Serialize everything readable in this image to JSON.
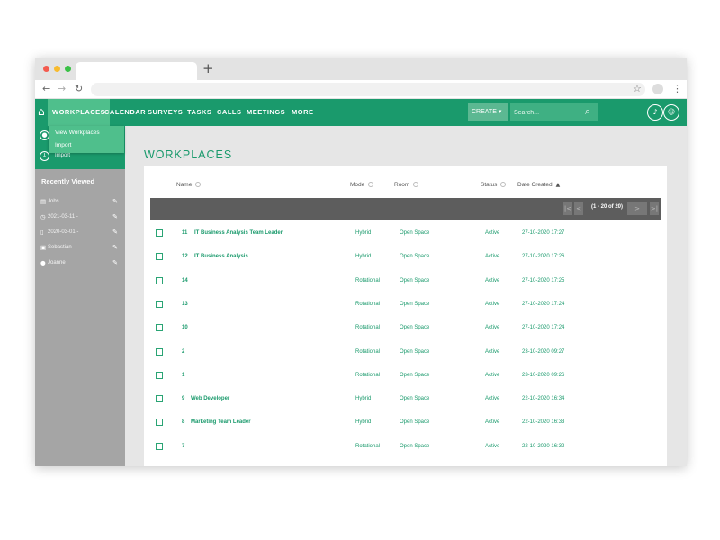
{
  "browser": {
    "new_tab": "+",
    "back": "←",
    "forward": "→",
    "reload": "↻",
    "star": "☆",
    "menu": "⋮"
  },
  "nav": {
    "items": [
      "WORKPLACES",
      "CALENDAR",
      "SURVEYS",
      "TASKS",
      "CALLS",
      "MEETINGS",
      "MORE"
    ],
    "create_label": "CREATE ▾",
    "search_placeholder": "Search...",
    "colors": {
      "primary": "#1a9a6c",
      "active": "#4fbf8c",
      "sidebar": "#a5a5a5"
    }
  },
  "dropdown": {
    "items": [
      "View Workplaces",
      "Import"
    ]
  },
  "sidebar": {
    "import_label": "Import",
    "recent_title": "Recently Viewed",
    "recent": [
      {
        "icon": "table-icon",
        "label": "Jobs"
      },
      {
        "icon": "clock-icon",
        "label": "2021-03-11 -"
      },
      {
        "icon": "document-icon",
        "label": "2020-03-01 -"
      },
      {
        "icon": "contact-icon",
        "label": "Sebastian"
      },
      {
        "icon": "user-icon",
        "label": "Joanne"
      }
    ]
  },
  "page": {
    "title": "WORKPLACES"
  },
  "table": {
    "headers": {
      "name": "Name",
      "mode": "Mode",
      "room": "Room",
      "status": "Status",
      "date": "Date Created"
    },
    "pager": {
      "range": "(1 - 20 of 20)",
      "first": "|<",
      "prev": "<",
      "next": ">",
      "last": ">|"
    },
    "rows": [
      {
        "num": "11",
        "name": "IT Business Analysis Team Leader",
        "mode": "Hybrid",
        "room": "Open Space",
        "status": "Active",
        "date": "27-10-2020 17:27"
      },
      {
        "num": "12",
        "name": "IT Business Analysis",
        "mode": "Hybrid",
        "room": "Open Space",
        "status": "Active",
        "date": "27-10-2020 17:26"
      },
      {
        "num": "14",
        "name": "",
        "mode": "Rotational",
        "room": "Open Space",
        "status": "Active",
        "date": "27-10-2020 17:25"
      },
      {
        "num": "13",
        "name": "",
        "mode": "Rotational",
        "room": "Open Space",
        "status": "Active",
        "date": "27-10-2020 17:24"
      },
      {
        "num": "10",
        "name": "",
        "mode": "Rotational",
        "room": "Open Space",
        "status": "Active",
        "date": "27-10-2020 17:24"
      },
      {
        "num": "2",
        "name": "",
        "mode": "Rotational",
        "room": "Open Space",
        "status": "Active",
        "date": "23-10-2020 09:27"
      },
      {
        "num": "1",
        "name": "",
        "mode": "Rotational",
        "room": "Open Space",
        "status": "Active",
        "date": "23-10-2020 09:26"
      },
      {
        "num": "9",
        "name": "Web Developer",
        "mode": "Hybrid",
        "room": "Open Space",
        "status": "Active",
        "date": "22-10-2020 16:34"
      },
      {
        "num": "8",
        "name": "Marketing Team Leader",
        "mode": "Hybrid",
        "room": "Open Space",
        "status": "Active",
        "date": "22-10-2020 16:33"
      },
      {
        "num": "7",
        "name": "",
        "mode": "Rotational",
        "room": "Open Space",
        "status": "Active",
        "date": "22-10-2020 16:32"
      }
    ]
  }
}
